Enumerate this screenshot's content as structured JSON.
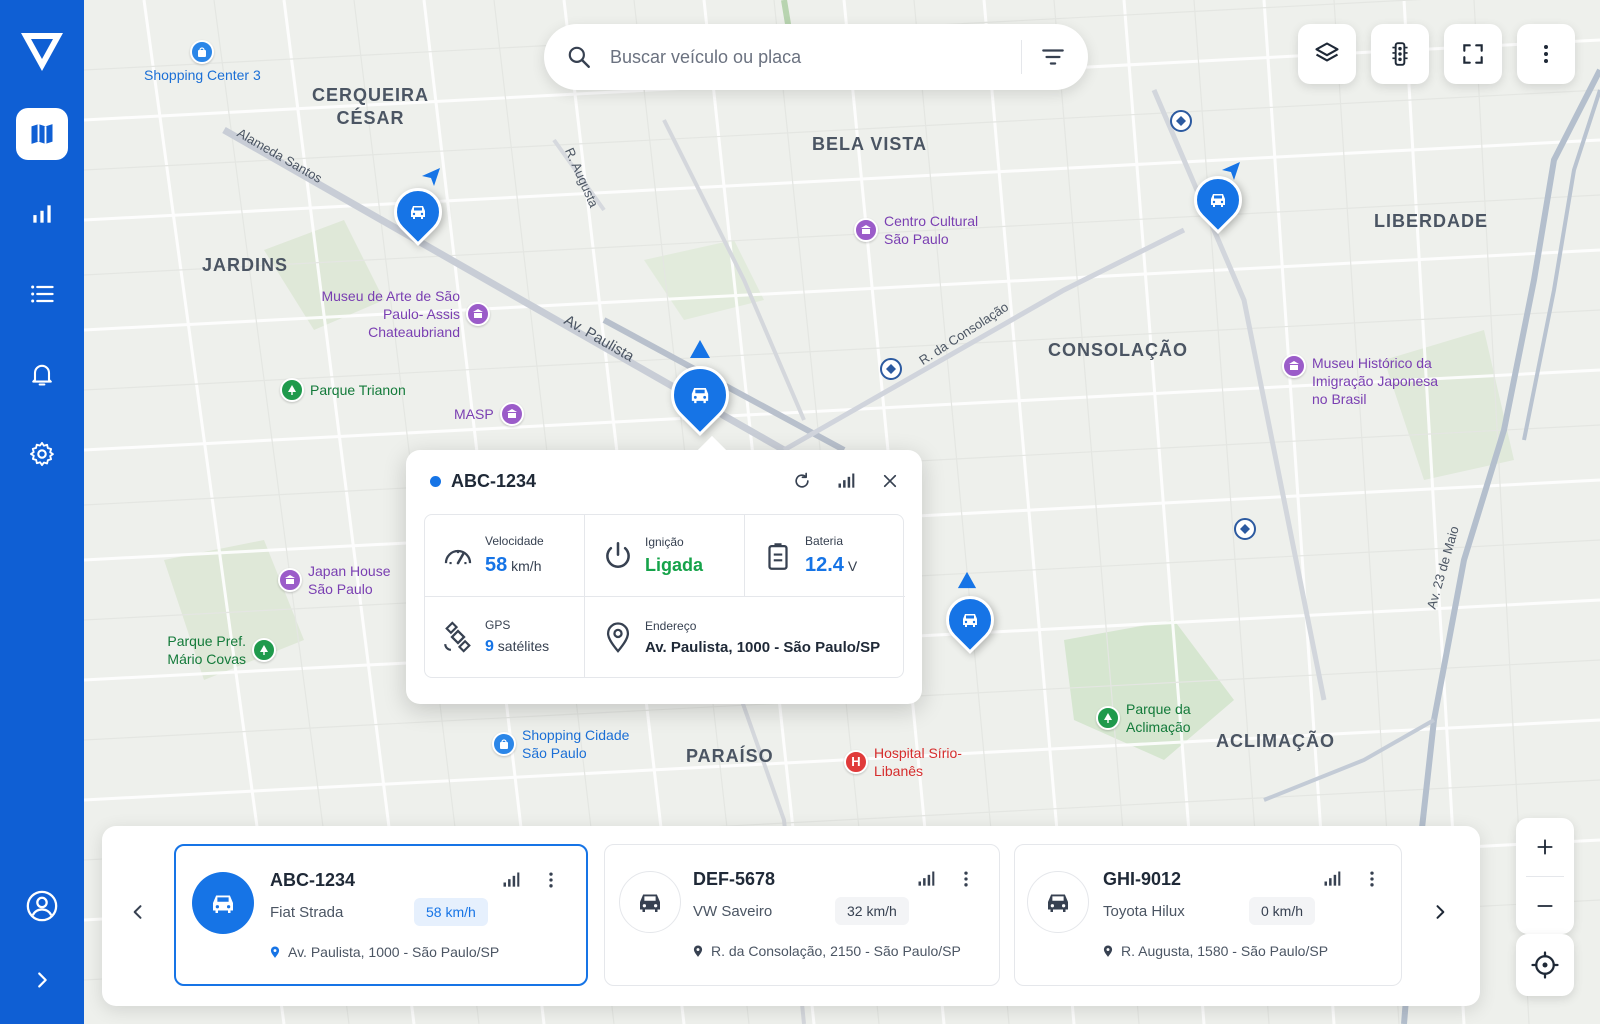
{
  "sidebar": {
    "logo_icon": "brand-logo-icon",
    "items": [
      {
        "name": "map",
        "icon": "map-icon",
        "active": true
      },
      {
        "name": "reports",
        "icon": "bar-chart-icon",
        "active": false
      },
      {
        "name": "list",
        "icon": "list-icon",
        "active": false
      },
      {
        "name": "alerts",
        "icon": "bell-icon",
        "active": false
      },
      {
        "name": "settings",
        "icon": "gear-icon",
        "active": false
      }
    ],
    "profile_icon": "user-circle-icon",
    "expand_icon": "chevron-right-icon"
  },
  "search": {
    "placeholder": "Buscar veículo ou placa",
    "value": ""
  },
  "toolbar": {
    "buttons": [
      "layers-icon",
      "traffic-light-icon",
      "fullscreen-icon",
      "more-vertical-icon"
    ]
  },
  "map": {
    "districts": [
      "CERQUEIRA CÉSAR",
      "BELA VISTA",
      "LIBERDADE",
      "JARDINS",
      "CONSOLAÇÃO",
      "PARAÍSO",
      "ACLIMAÇÃO"
    ],
    "streets": [
      "Alameda Santos",
      "R. Augusta",
      "Av. Paulista",
      "R. da Consolação",
      "Av. 23 de Maio"
    ],
    "pois": [
      {
        "label": "Shopping Center 3",
        "kind": "shopping"
      },
      {
        "label": "Centro Cultural São Paulo",
        "kind": "museum"
      },
      {
        "label": "Museu de Arte de São Paulo- Assis Chateaubriand",
        "kind": "museum"
      },
      {
        "label": "Parque Trianon",
        "kind": "park"
      },
      {
        "label": "MASP",
        "kind": "museum"
      },
      {
        "label": "Museu Histórico da Imigração Japonesa no Brasil",
        "kind": "museum"
      },
      {
        "label": "Japan House São Paulo",
        "kind": "museum"
      },
      {
        "label": "Parque Pref. Mário Covas",
        "kind": "park"
      },
      {
        "label": "Shopping Cidade São Paulo",
        "kind": "shopping"
      },
      {
        "label": "Hospital Sírio-Libanês",
        "kind": "hospital"
      },
      {
        "label": "Parque da Aclimação",
        "kind": "park"
      }
    ]
  },
  "popup": {
    "plate": "ABC-1234",
    "status_color": "#1674e6",
    "speed_label": "Velocidade",
    "speed_value": "58",
    "speed_unit": "km/h",
    "ignition_label": "Ignição",
    "ignition_value": "Ligada",
    "battery_label": "Bateria",
    "battery_value": "12.4",
    "battery_unit": "V",
    "gps_label": "GPS",
    "gps_value": "9",
    "gps_unit": "satélites",
    "address_label": "Endereço",
    "address_value": "Av. Paulista, 1000 - São Paulo/SP"
  },
  "vehicles": [
    {
      "plate": "ABC-1234",
      "model": "Fiat Strada",
      "speed": "58 km/h",
      "address": "Av. Paulista, 1000 - São Paulo/SP",
      "active": true
    },
    {
      "plate": "DEF-5678",
      "model": "VW Saveiro",
      "speed": "32 km/h",
      "address": "R. da Consolação, 2150 - São Paulo/SP",
      "active": false
    },
    {
      "plate": "GHI-9012",
      "model": "Toyota Hilux",
      "speed": "0 km/h",
      "address": "R. Augusta, 1580 - São Paulo/SP",
      "active": false
    }
  ],
  "colors": {
    "brand": "#0f5fd4",
    "accent": "#1674e6",
    "ignition_on": "#16a34a"
  }
}
